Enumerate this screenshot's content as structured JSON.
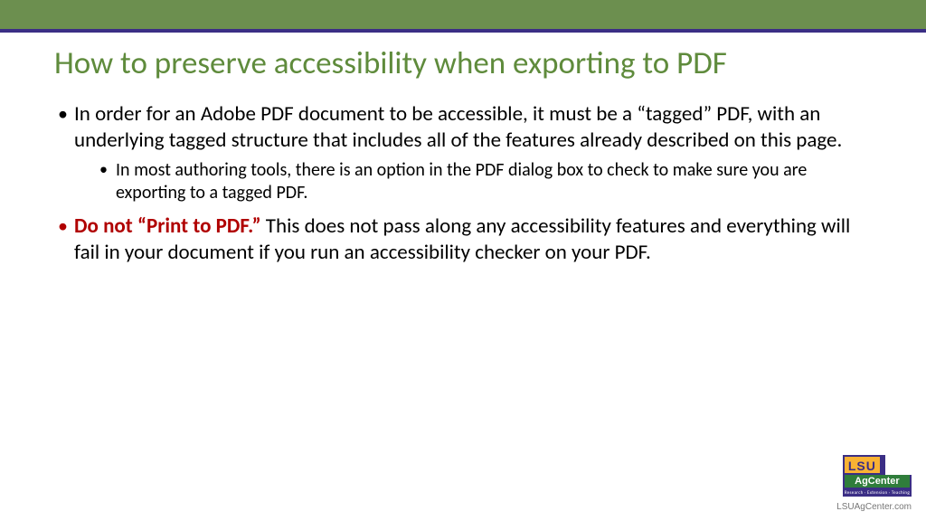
{
  "title": "How to preserve accessibility when exporting to PDF",
  "bullets": {
    "b1": "In order for an Adobe PDF document to be accessible, it must be a “tagged” PDF, with an underlying tagged structure that includes all of the features already described on this page.",
    "b1_sub1": "In most authoring tools, there is an option in the PDF dialog box to check to make sure you are exporting to a tagged PDF.",
    "b2_emph": "Do not “Print to PDF.” ",
    "b2_rest": "This does not pass along any accessibility features and everything will fail in your document if you run an accessibility checker on your PDF."
  },
  "logo": {
    "lsu": "LSU",
    "agcenter": "AgCenter",
    "tag": "Research · Extension · Teaching",
    "site": "LSUAgCenter.com"
  }
}
